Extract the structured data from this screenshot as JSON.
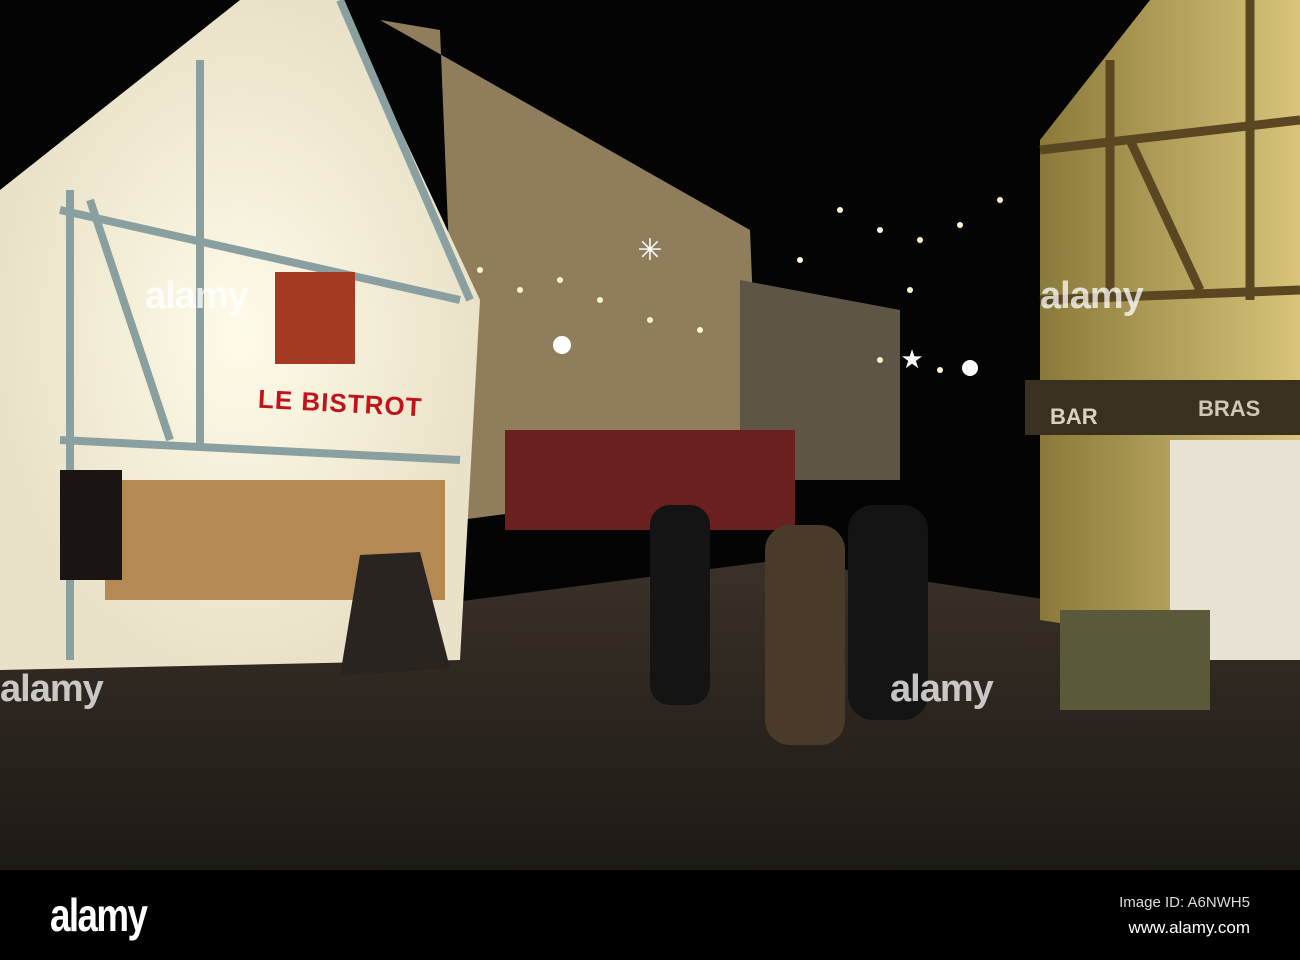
{
  "scene": {
    "signs": {
      "bistrot": "LE BISTROT",
      "bar": "BAR",
      "brasserie_partial": "BRAS"
    },
    "watermark": "alamy"
  },
  "footer": {
    "logo": "alamy",
    "image_id": "Image ID: A6NWH5",
    "website": "www.alamy.com"
  }
}
